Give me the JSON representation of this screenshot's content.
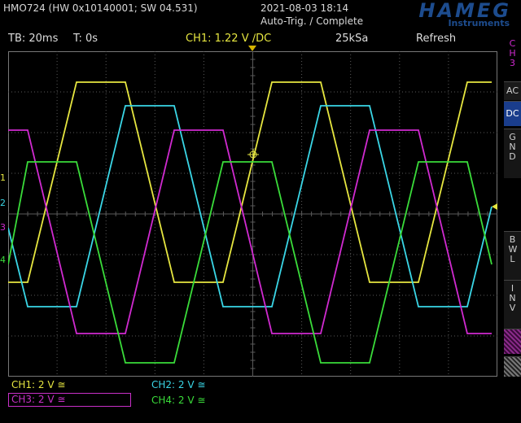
{
  "header": {
    "title": "HMO724 (HW 0x10140001; SW 04.531)",
    "datetime": "2021-08-03 18:14",
    "trigger_status": "Auto-Trig. / Complete",
    "logo_brand": "HAMEG",
    "logo_sub": "Instruments"
  },
  "statusbar": {
    "timebase": "TB: 20ms",
    "time_offset": "T: 0s",
    "ch1_setting": "CH1: 1.22 V ∕DC",
    "sample_rate": "25kSa",
    "mode": "Refresh"
  },
  "markers": [
    "1",
    "2",
    "3",
    "4"
  ],
  "right_panel": {
    "channel_tab": "CH3",
    "ac": "AC",
    "dc": "DC",
    "gnd": "GND",
    "bwl": "BWL",
    "inv": "INV"
  },
  "channel_labels": {
    "ch1": "CH1: 2 V ≅",
    "ch2": "CH2: 2 V ≅",
    "ch3": "CH3: 2 V ≅",
    "ch4": "CH4: 2 V ≅"
  },
  "colors": {
    "ch1": "#e6e640",
    "ch2": "#3ad6e6",
    "ch3": "#d02ad0",
    "ch4": "#3adc3a",
    "grid": "#5a5a5a",
    "dc_selected": "#1a3d8c"
  }
}
